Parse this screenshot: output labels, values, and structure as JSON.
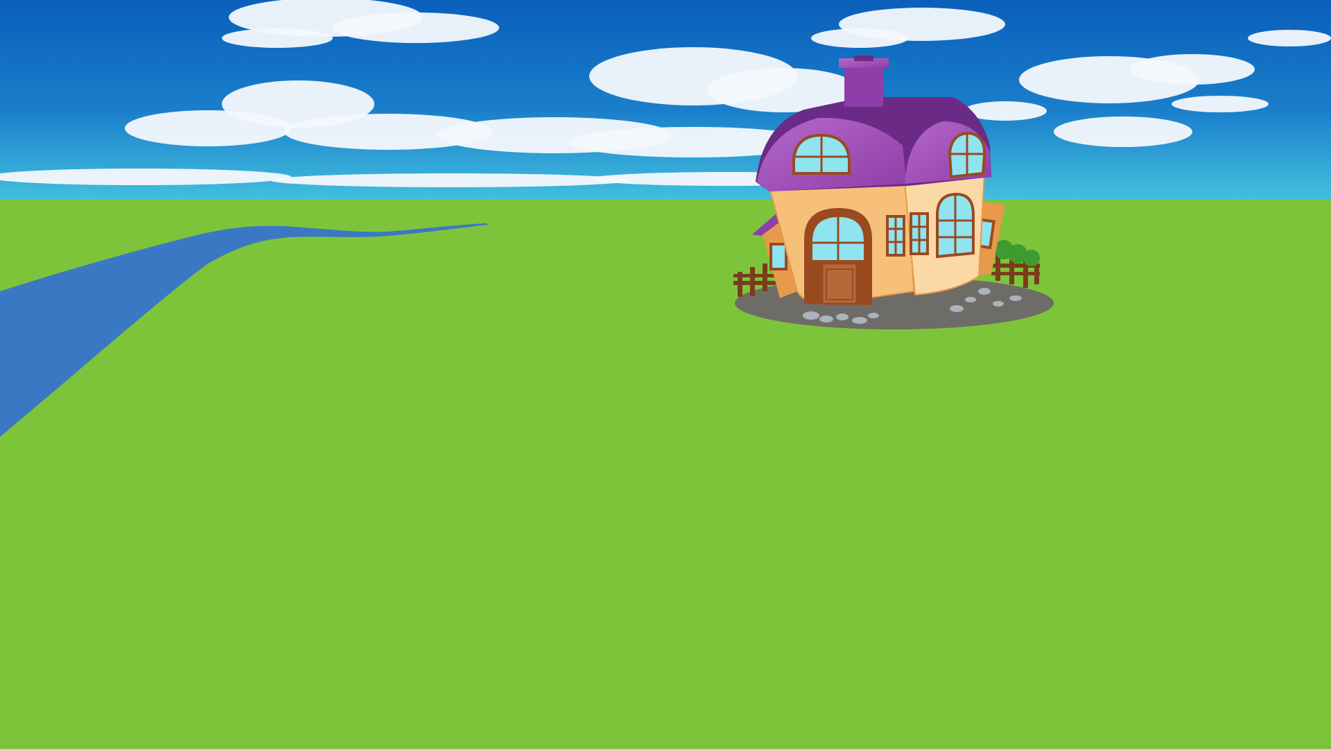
{
  "scene": {
    "name": "meadow-with-cottage",
    "colors": {
      "sky_top": "#0a5fbb",
      "sky_mid": "#1a7fcb",
      "sky_horizon": "#43c0de",
      "grass": "#7dc43b",
      "river": "#3b78c4",
      "cloud": "#f4f8fc",
      "cloud_shade": "#c9dcef",
      "roof": "#8d3ea8",
      "roof_light": "#b568c9",
      "roof_dark": "#6b2a86",
      "wall": "#f7c07a",
      "wall_light": "#fbd9a6",
      "wall_shade": "#e79a4a",
      "window_glass": "#8fe4f0",
      "window_frame": "#9a4a1f",
      "door": "#b5693a",
      "fence": "#7a3d1c",
      "ground_patch": "#6e6c66",
      "stones": "#a9b4bd",
      "bush": "#3f9a2f"
    },
    "icons": [
      "sky-background",
      "cloud-icon",
      "river-icon",
      "cottage-icon",
      "chimney-icon",
      "fence-icon",
      "bush-icon"
    ]
  }
}
